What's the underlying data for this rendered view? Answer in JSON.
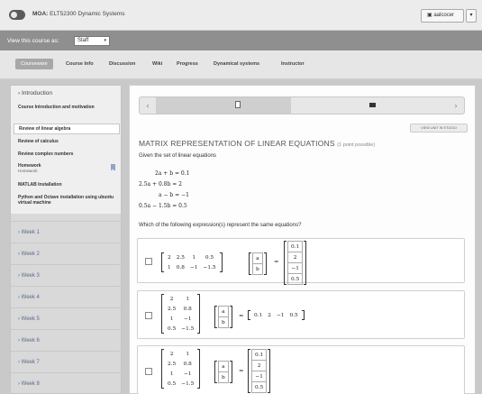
{
  "header": {
    "course_prefix": "MOA:",
    "course_name": "ELT52300 Dynamic Systems",
    "user": "aalcocer",
    "user_caret": "▾"
  },
  "view_bar": {
    "label": "View this course as:",
    "selected": "Staff",
    "caret": "▾"
  },
  "nav": {
    "items": [
      "Courseware",
      "Course Info",
      "Discussion",
      "Wiki",
      "Progress",
      "Dynamical systems",
      "Instructor"
    ]
  },
  "sidebar": {
    "chapter": "› Introduction",
    "sections": [
      {
        "label": "Course Introduction and motivation"
      },
      {
        "label": "Review of linear algebra"
      },
      {
        "label": "Review of calculus"
      },
      {
        "label": "Review complex numbers"
      },
      {
        "label": "Homework",
        "sub": "Homework"
      },
      {
        "label": "MATLAB Installation"
      },
      {
        "label": "Python and Octave installation using ubuntu virtual machine"
      }
    ],
    "weeks": [
      "› Week 1",
      "› Week 2",
      "› Week 3",
      "› Week 4",
      "› Week 5",
      "› Week 6",
      "› Week 7",
      "› Week 8"
    ]
  },
  "sequence": {
    "prev": "‹",
    "next": "›"
  },
  "main": {
    "studio_button": "VIEW UNIT IN STUDIO",
    "title": "MATRIX REPRESENTATION OF LINEAR EQUATIONS",
    "points": "(1 point possible)",
    "given_text": "Given the set of linear equations",
    "equations": [
      "2a + b = 0.1",
      "2.5a + 0.8b = 2",
      "a − b = −1",
      "0.5a − 1.5b = 0.5"
    ],
    "question": "Which of the following expression(s) represent the same equations?"
  },
  "choices": [
    {
      "m1": [
        [
          "2",
          "2.5",
          "1",
          "0.5"
        ],
        [
          "1",
          "0.8",
          "−1",
          "−1.5"
        ]
      ],
      "m2": [
        [
          "a"
        ],
        [
          "b"
        ]
      ],
      "m3": [
        [
          "0.1"
        ],
        [
          "2"
        ],
        [
          "−1"
        ],
        [
          "0.5"
        ]
      ]
    },
    {
      "m1": [
        [
          "2",
          "1"
        ],
        [
          "2.5",
          "0.8"
        ],
        [
          "1",
          "−1"
        ],
        [
          "0.5",
          "−1.5"
        ]
      ],
      "m2": [
        [
          "a"
        ],
        [
          "b"
        ]
      ],
      "m3": [
        [
          "0.1",
          "2",
          "−1",
          "0.5"
        ]
      ]
    },
    {
      "m1": [
        [
          "2",
          "1"
        ],
        [
          "2.5",
          "0.8"
        ],
        [
          "1",
          "−1"
        ],
        [
          "0.5",
          "−1.5"
        ]
      ],
      "m2": [
        [
          "a"
        ],
        [
          "b"
        ]
      ],
      "m3": [
        [
          "0.1"
        ],
        [
          "2"
        ],
        [
          "−1"
        ],
        [
          "0.5"
        ]
      ]
    }
  ],
  "symbols": {
    "equals": "="
  },
  "colors": {
    "accent": "#a8a8a8",
    "link": "#5a6a8a"
  }
}
